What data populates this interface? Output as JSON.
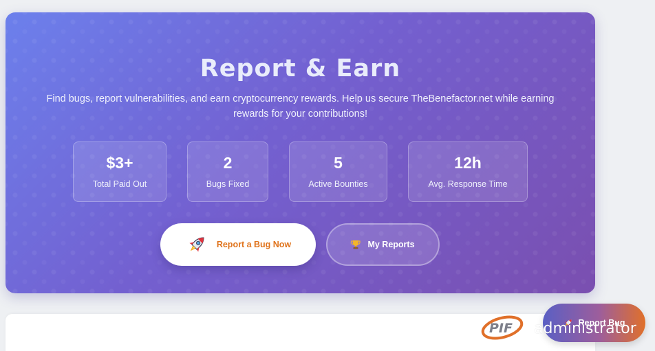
{
  "hero": {
    "title": "Report & Earn",
    "subtitle": "Find bugs, report vulnerabilities, and earn cryptocurrency rewards. Help us secure TheBenefactor.net while earning rewards for your contributions!"
  },
  "stats": [
    {
      "value": "$3+",
      "label": "Total Paid Out"
    },
    {
      "value": "2",
      "label": "Bugs Fixed"
    },
    {
      "value": "5",
      "label": "Active Bounties"
    },
    {
      "value": "12h",
      "label": "Avg. Response Time"
    }
  ],
  "actions": {
    "report_label": "Report a Bug Now",
    "report_icon": "rocket-icon",
    "reports_label": "My Reports",
    "reports_icon": "trophy-icon"
  },
  "floating": {
    "label": "Report Bug",
    "icon": "rocket-icon"
  },
  "user": {
    "name": "administrator"
  },
  "colors": {
    "accent_orange": "#e0741d",
    "hero_start": "#6c80ec",
    "hero_end": "#7a4fb0"
  }
}
